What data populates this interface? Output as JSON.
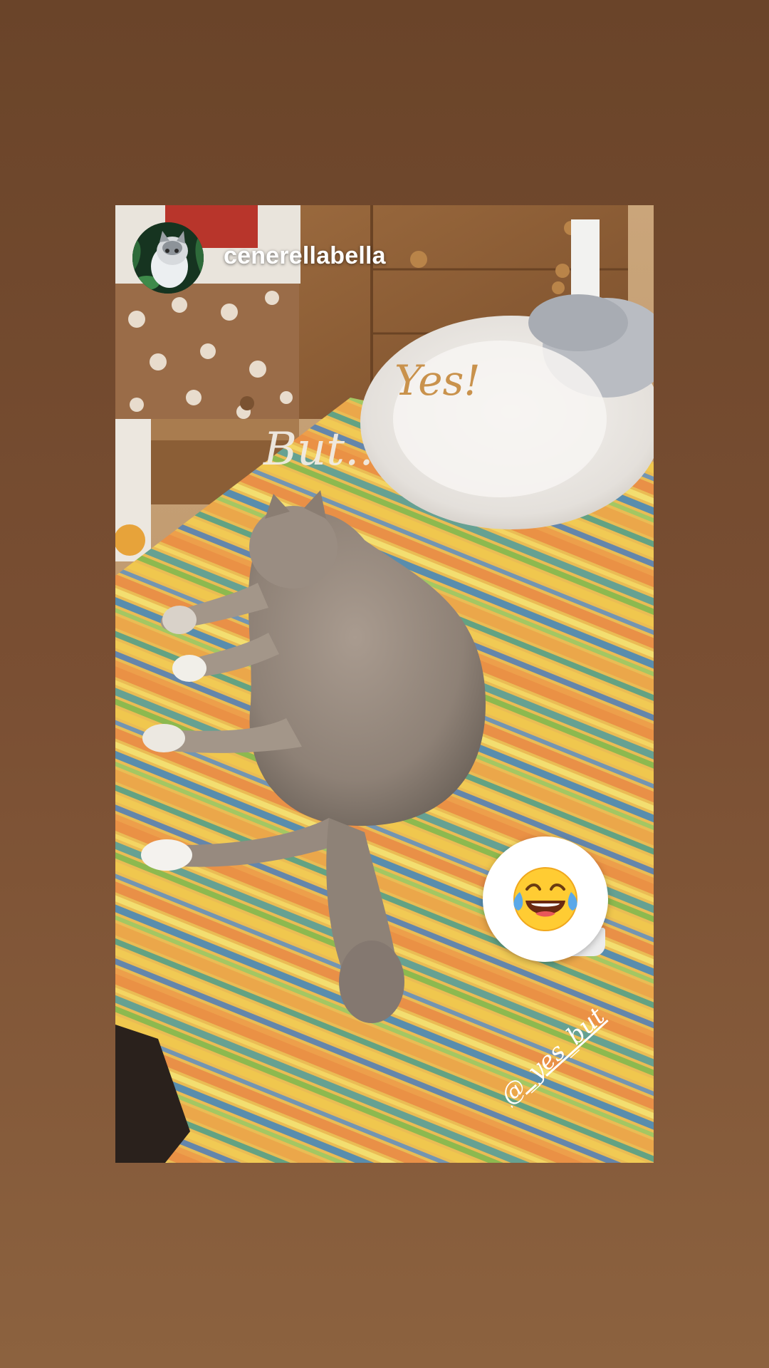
{
  "story": {
    "username": "cenerellabella",
    "caption_yes": "Yes!",
    "caption_but": "But..",
    "watermark": "@_yes_but"
  },
  "sticker": {
    "emoji_icon": "face-with-tears-of-joy-icon"
  },
  "colors": {
    "background_top": "#6a4429",
    "background_bottom": "#8c623f",
    "caption_yes": "#c9924c",
    "caption_but": "#f1ece4",
    "username": "#ffffff"
  }
}
